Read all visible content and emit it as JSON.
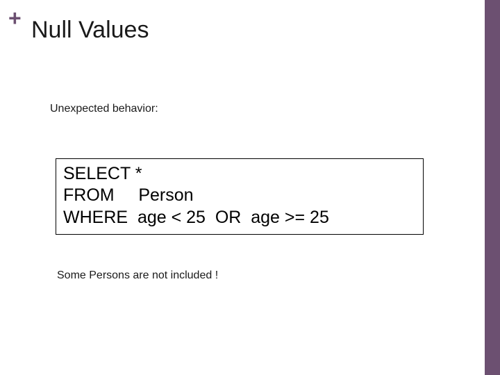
{
  "header": {
    "plus_symbol": "+",
    "title": "Null Values"
  },
  "body": {
    "subtitle": "Unexpected behavior:",
    "code": {
      "line1": "SELECT *",
      "line2": "FROM     Person",
      "line3": "WHERE  age < 25  OR  age >= 25"
    },
    "footnote": "Some Persons are not included !"
  }
}
